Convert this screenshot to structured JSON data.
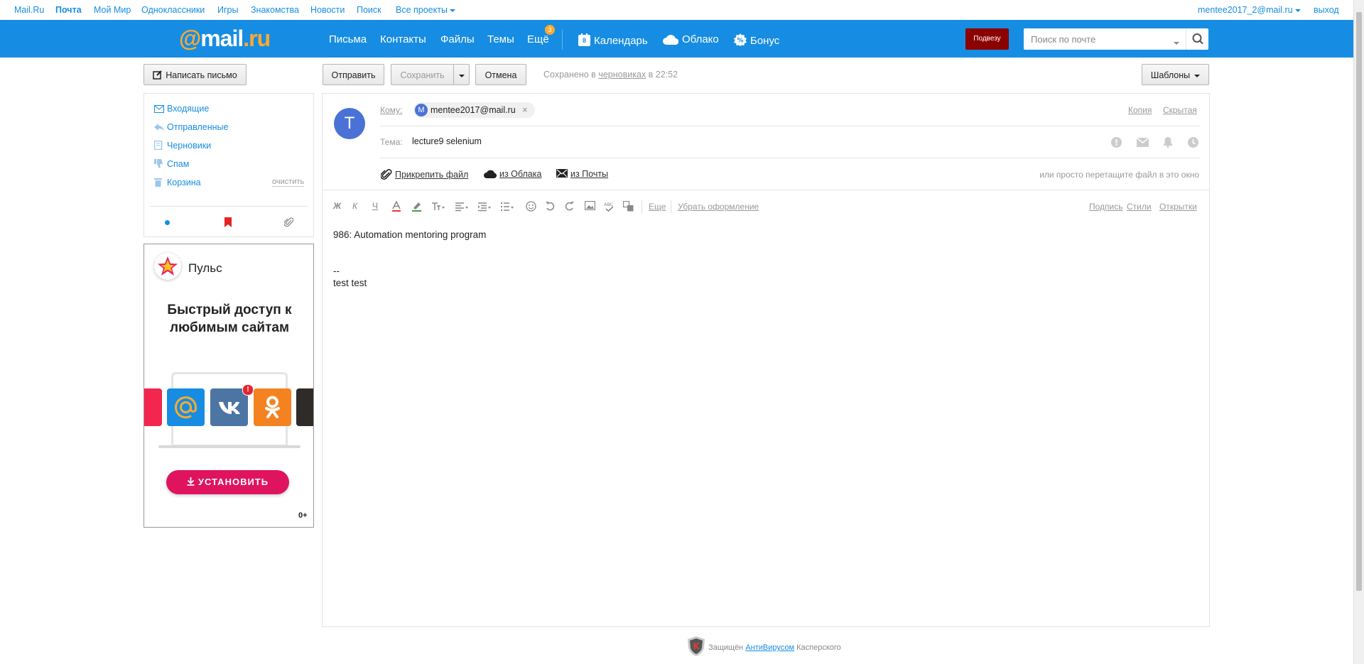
{
  "portal": {
    "links": [
      "Mail.Ru",
      "Почта",
      "Мой Мир",
      "Одноклассники",
      "Игры",
      "Знакомства",
      "Новости",
      "Поиск"
    ],
    "all_projects": "Все проекты",
    "user_email": "mentee2017_2@mail.ru",
    "logout": "выход"
  },
  "header": {
    "logo": {
      "at": "@",
      "mail": "mail",
      "ru": ".ru"
    },
    "nav": [
      "Письма",
      "Контакты",
      "Файлы",
      "Темы",
      "Ещё"
    ],
    "more_badge": "3",
    "apps": {
      "calendar": "Календарь",
      "calendar_day": "8",
      "cloud": "Облако",
      "bonus": "Бонус"
    },
    "promo": "Подвезу",
    "search_placeholder": "Поиск по почте"
  },
  "toolbar": {
    "write": "Написать письмо",
    "send": "Отправить",
    "save": "Сохранить",
    "cancel": "Отмена",
    "saved_prefix": "Сохранено в",
    "saved_link": "черновиках",
    "saved_suffix": "в 22:52",
    "templates": "Шаблоны"
  },
  "sidebar": {
    "folders": [
      "Входящие",
      "Отправленные",
      "Черновики",
      "Спам",
      "Корзина"
    ],
    "clear": "очистить"
  },
  "ad": {
    "brand": "Пульс",
    "headline": "Быстрый доступ к любимым сайтам",
    "install": "УСТАНОВИТЬ",
    "age": "0+"
  },
  "compose": {
    "avatar_letter": "T",
    "to_label": "Кому:",
    "recipient_initial": "M",
    "recipient": "mentee2017@mail.ru",
    "cc": "Копия",
    "bcc": "Скрытая",
    "subject_label": "Тема:",
    "subject": "lecture9 selenium",
    "attach_file": "Прикрепить файл",
    "from_cloud": "из Облака",
    "from_mail": "из Почты",
    "drag_hint": "или просто перетащите файл в это окно",
    "format_more": "Еще",
    "clear_format": "Убрать оформление",
    "signature": "Подпись",
    "styles": "Стили",
    "postcards": "Открытки",
    "body": "986: Automation mentoring program\n\n\n--\ntest test"
  },
  "footer": {
    "prefix": "Защищён",
    "link": "АнтиВирусом",
    "suffix": "Касперского"
  },
  "colors": {
    "brand_blue": "#168de2",
    "orange": "#ffa930",
    "promo": "#8c0000",
    "install": "#e0145e"
  }
}
